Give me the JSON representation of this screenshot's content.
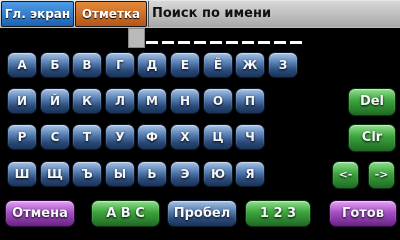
{
  "tabs": {
    "main_screen": "Гл. экран",
    "mark": "Отметка"
  },
  "title": "Поиск по имени",
  "keyboard": {
    "rows": [
      [
        "А",
        "Б",
        "В",
        "Г",
        "Д",
        "Е",
        "Ё",
        "Ж",
        "З"
      ],
      [
        "И",
        "Й",
        "К",
        "Л",
        "М",
        "Н",
        "О",
        "П"
      ],
      [
        "Р",
        "С",
        "Т",
        "У",
        "Ф",
        "Х",
        "Ц",
        "Ч"
      ],
      [
        "Ш",
        "Щ",
        "Ъ",
        "Ы",
        "Ь",
        "Э",
        "Ю",
        "Я"
      ]
    ],
    "delete": "Del",
    "clear": "Clr",
    "left_arrow": "<-",
    "right_arrow": "->"
  },
  "bottom_bar": {
    "cancel": "Отмена",
    "latin": "A B C",
    "space": "Пробел",
    "digits": "1 2 3",
    "done": "Готов"
  },
  "colors": {
    "letter_key": "#3a5f94",
    "function_key_green": "#3ca43c",
    "function_key_purple": "#a650c4",
    "tab_main": "#2a77cc",
    "tab_mark": "#cc6d28"
  },
  "input": {
    "value": ""
  }
}
